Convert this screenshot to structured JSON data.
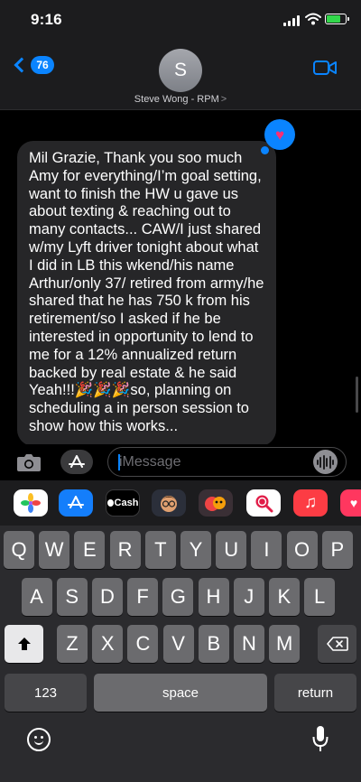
{
  "status": {
    "time": "9:16"
  },
  "header": {
    "back_count": "76",
    "avatar_initial": "S",
    "contact_name": "Steve Wong - RPM",
    "contact_arrow": ">"
  },
  "message": {
    "text": "Mil Grazie, Thank you soo much Amy for everything/I’m goal setting, want to finish the HW u gave us about texting & reaching out to many contacts... CAW/I just shared w/my Lyft driver tonight about what I did in LB this wkend/his name Arthur/only 37/ retired from army/he shared that he has 750 k from his retirement/so I asked if he be interested in opportunity to lend to me for a 12% annualized return backed by real estate & he said Yeah!!!🎉🎉🎉so, planning on scheduling a in person session to show how this works...",
    "tapback": "♥"
  },
  "input": {
    "placeholder": "iMessage"
  },
  "apps": {
    "cash_label": "Cash",
    "music_glyph": "♫"
  },
  "keyboard": {
    "row1": [
      "Q",
      "W",
      "E",
      "R",
      "T",
      "Y",
      "U",
      "I",
      "O",
      "P"
    ],
    "row2": [
      "A",
      "S",
      "D",
      "F",
      "G",
      "H",
      "J",
      "K",
      "L"
    ],
    "row3": [
      "Z",
      "X",
      "C",
      "V",
      "B",
      "N",
      "M"
    ],
    "numbers_label": "123",
    "space_label": "space",
    "return_label": "return"
  },
  "colors": {
    "accent": "#0a84ff",
    "heart": "#ff2d75",
    "bubble": "#262628"
  }
}
